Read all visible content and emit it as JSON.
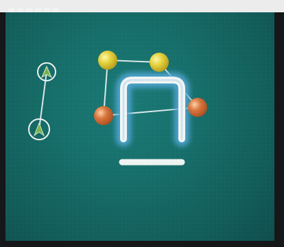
{
  "colors": {
    "background": "#176f6b",
    "yellow_node": "#e0d240",
    "orange_node": "#d8743f",
    "bar_glow": "#55a8d8",
    "bar_core": "#eef4f2",
    "ship_icon": "#7fb24a"
  },
  "icons": [
    "ship-up-icon",
    "ship-up-icon"
  ]
}
